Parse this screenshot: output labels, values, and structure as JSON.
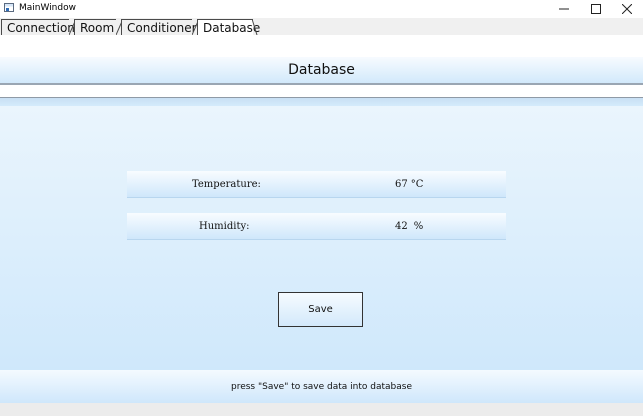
{
  "window": {
    "title": "MainWindow",
    "controls": {
      "minimize_icon": "minimize-icon",
      "maximize_icon": "maximize-icon",
      "close_icon": "close-icon"
    }
  },
  "tabs": [
    {
      "label": "Connection",
      "active": false
    },
    {
      "label": "Room",
      "active": false
    },
    {
      "label": "Conditioner",
      "active": false
    },
    {
      "label": "Database",
      "active": true
    }
  ],
  "page": {
    "title": "Database",
    "fields": {
      "temperature": {
        "label": "Temperature:",
        "value": "67",
        "unit": "°C"
      },
      "humidity": {
        "label": "Humidity:",
        "value": "42",
        "unit": "%"
      }
    },
    "save_label": "Save",
    "hint": "press \"Save\" to save data into database"
  },
  "colors": {
    "band_top": "#f7fbff",
    "band_bottom": "#d2e9fb",
    "panel_light": "#eaf5fd",
    "panel_dark": "#cfe8fb"
  }
}
